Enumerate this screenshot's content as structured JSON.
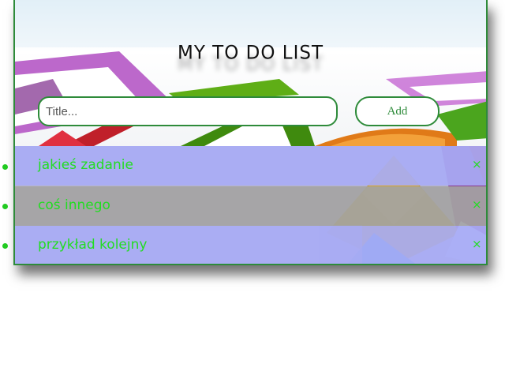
{
  "header": {
    "title": "MY TO DO LIST"
  },
  "form": {
    "title_placeholder": "Title...",
    "title_value": "",
    "add_label": "Add"
  },
  "tasks": [
    {
      "text": "jakieś zadanie",
      "delete_label": "×"
    },
    {
      "text": "coś innego",
      "delete_label": "×"
    },
    {
      "text": "przykład kolejny",
      "delete_label": "×"
    }
  ],
  "colors": {
    "accent": "#2e8b3a",
    "task_text": "#22dd22",
    "row_blue": "#a8acf6",
    "row_gray": "#a4a4a4"
  }
}
